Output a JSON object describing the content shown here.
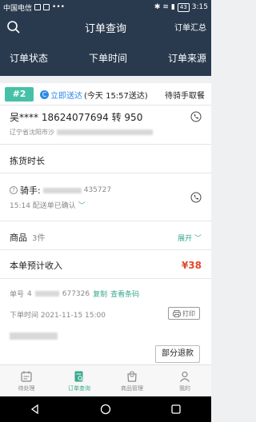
{
  "status_bar": {
    "carrier": "中国电信",
    "battery": "43",
    "time": "3:15"
  },
  "header": {
    "title": "订单查询",
    "summary_label": "订单汇总"
  },
  "filters": [
    "订单状态",
    "下单时间",
    "订单来源"
  ],
  "order": {
    "badge": "#2",
    "delivery_mode": "立即送达",
    "delivery_time": "(今天 15:57送达)",
    "status": "待骑手取餐",
    "customer": "吴**** 18624077694 转 950",
    "address_prefix": "辽宁省沈阳市沙",
    "picking_time_label": "拣货时长",
    "rider_label": "骑手:",
    "rider_phone_tail": "435727",
    "dispatch": "15:14 配送单已确认",
    "goods_label": "商品",
    "goods_count": "3件",
    "expand_label": "展开",
    "income_label": "本单预计收入",
    "income_value": "¥38",
    "order_no_label": "单号",
    "order_no_prefix": "4",
    "order_no_tail": "677326",
    "copy_label": "复制",
    "barcode_label": "查看条码",
    "order_time": "下单时间  2021-11-15 15:00",
    "print_label": "打印",
    "refund_label": "部分退款"
  },
  "tabs": [
    {
      "label": "待处理",
      "icon": "calendar-icon",
      "active": false
    },
    {
      "label": "订单查询",
      "icon": "order-search-icon",
      "active": true
    },
    {
      "label": "商品管理",
      "icon": "shopping-bag-icon",
      "active": false
    },
    {
      "label": "我的",
      "icon": "person-icon",
      "active": false
    }
  ],
  "colors": {
    "header_bg": "#2a3a4e",
    "accent": "#3aa98f",
    "badge": "#46c1a7",
    "price": "#e24a2a",
    "link_blue": "#2e8ae6"
  }
}
